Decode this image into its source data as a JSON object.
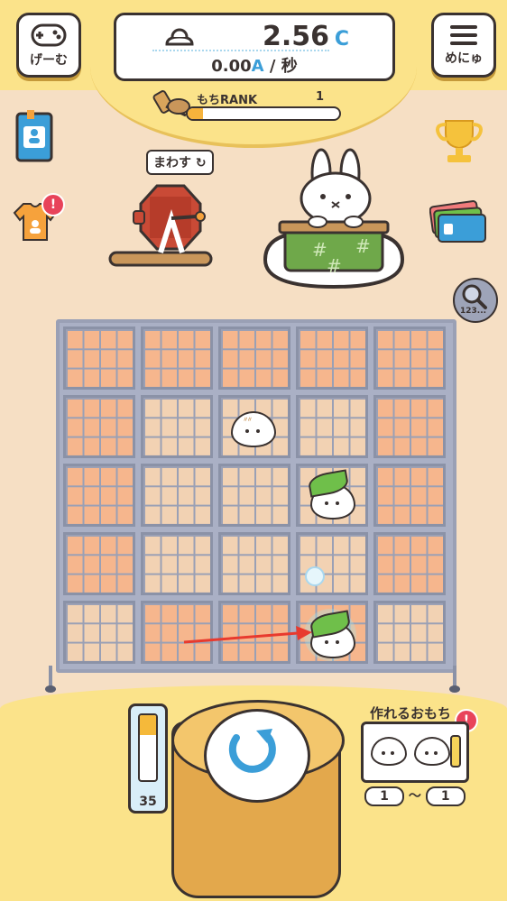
{
  "header": {
    "game_button_label": "げーむ",
    "menu_button_label": "めにゅ",
    "money_value": "2.56",
    "money_unit": "C",
    "rate_value": "0.00",
    "rate_unit": "A",
    "rate_suffix": "/ 秒"
  },
  "rank": {
    "label": "もちRANK",
    "level": "1",
    "progress": 0.1
  },
  "scene": {
    "spin_label": "まわす",
    "zoom_label": "123..."
  },
  "crafting": {
    "title": "作れるおもち",
    "range_min": "1",
    "range_sep": "〜",
    "range_max": "1",
    "alert": "!"
  },
  "pounder": {
    "count": "35",
    "fill_fraction": 0.3
  },
  "side_alert": "!"
}
